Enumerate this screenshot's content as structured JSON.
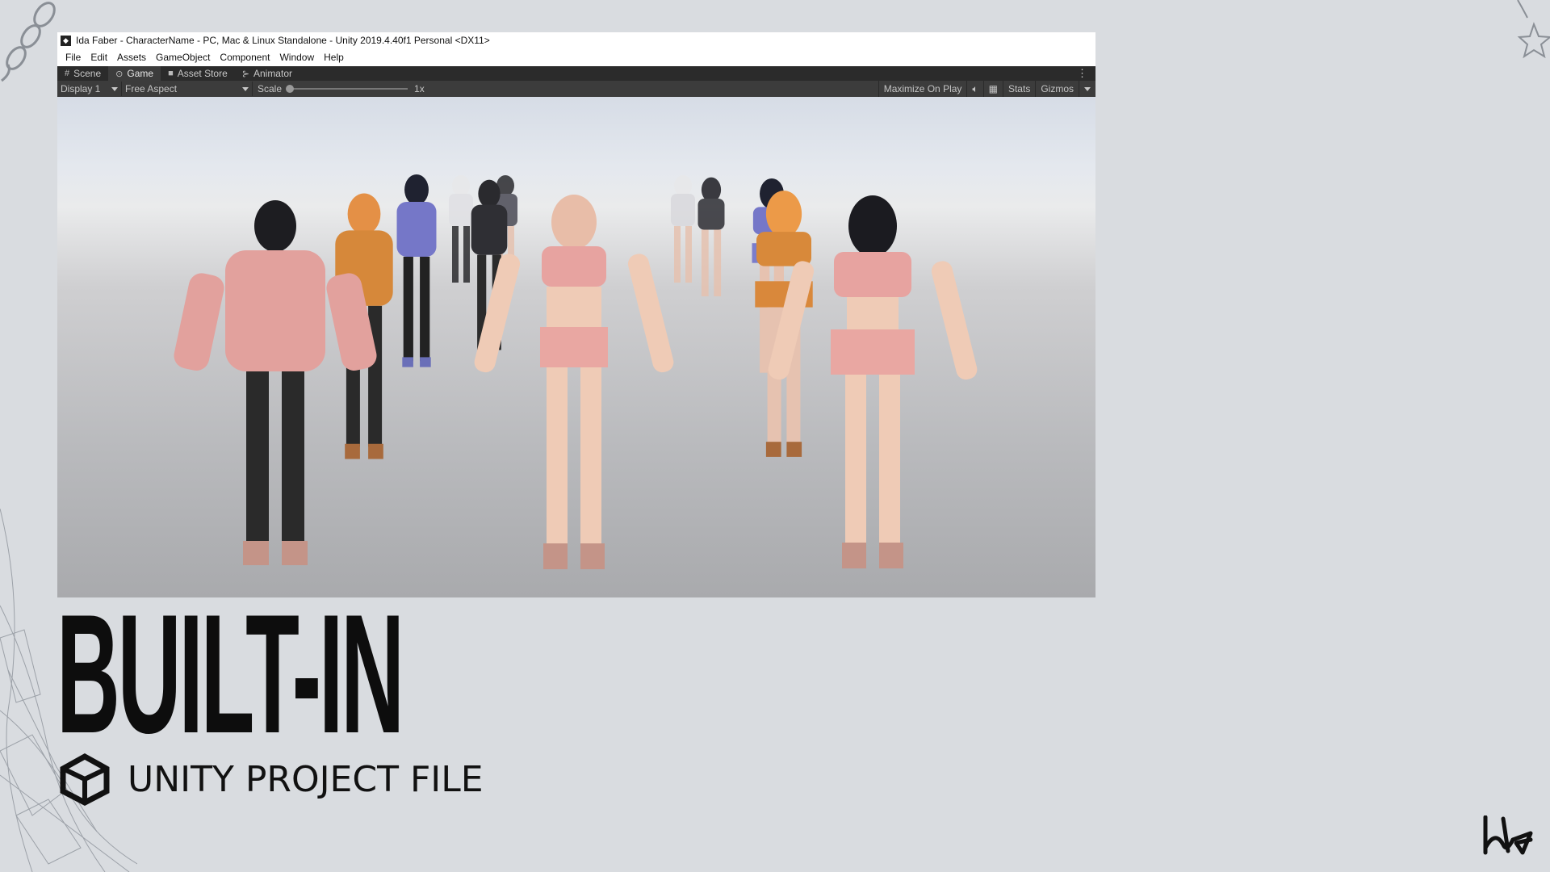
{
  "window": {
    "title": "Ida Faber - CharacterName - PC, Mac & Linux Standalone - Unity 2019.4.40f1 Personal <DX11>"
  },
  "menu": [
    "File",
    "Edit",
    "Assets",
    "GameObject",
    "Component",
    "Window",
    "Help"
  ],
  "tabs": [
    {
      "label": "Scene",
      "icon": "grid-icon"
    },
    {
      "label": "Game",
      "icon": "gamepad-icon",
      "active": true
    },
    {
      "label": "Asset Store",
      "icon": "store-icon"
    },
    {
      "label": "Animator",
      "icon": "animator-icon"
    }
  ],
  "toolbar": {
    "display": "Display 1",
    "aspect": "Free Aspect",
    "scale_label": "Scale",
    "scale_value": "1x",
    "maximize": "Maximize On Play",
    "mute_icon": "speaker-icon",
    "stats_icon": "grid-stats-icon",
    "stats": "Stats",
    "gizmos": "Gizmos"
  },
  "heading": "BUILT-IN",
  "subtitle": "UNITY PROJECT FILE",
  "colors": {
    "background": "#d9dce0",
    "editor_dark": "#3c3c3c",
    "tab_bar": "#2b2b2b",
    "heading": "#0d0d0d"
  }
}
